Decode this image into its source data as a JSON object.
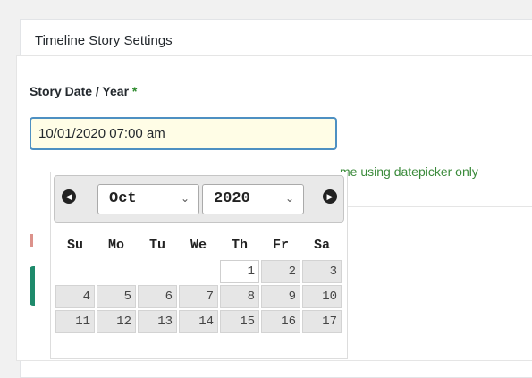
{
  "panel": {
    "title": "Timeline Story Settings"
  },
  "field": {
    "label": "Story Date / Year",
    "required_mark": "*",
    "value": "10/01/2020 07:00 am",
    "help_text_visible": "me using datepicker only"
  },
  "datepicker": {
    "prev_icon": "circle-left-triangle",
    "next_icon": "circle-right-triangle",
    "selected_month": "Oct",
    "selected_year": "2020",
    "weekdays": [
      "Su",
      "Mo",
      "Tu",
      "We",
      "Th",
      "Fr",
      "Sa"
    ],
    "weeks": [
      [
        "",
        "",
        "",
        "",
        "1",
        "2",
        "3"
      ],
      [
        "4",
        "5",
        "6",
        "7",
        "8",
        "9",
        "10"
      ],
      [
        "11",
        "12",
        "13",
        "14",
        "15",
        "16",
        "17"
      ]
    ],
    "today": "1"
  },
  "colors": {
    "input_border": "#4e90c2",
    "input_background": "#fffde6",
    "help_text": "#3a8a3a",
    "required_mark": "#2e8b2e"
  }
}
